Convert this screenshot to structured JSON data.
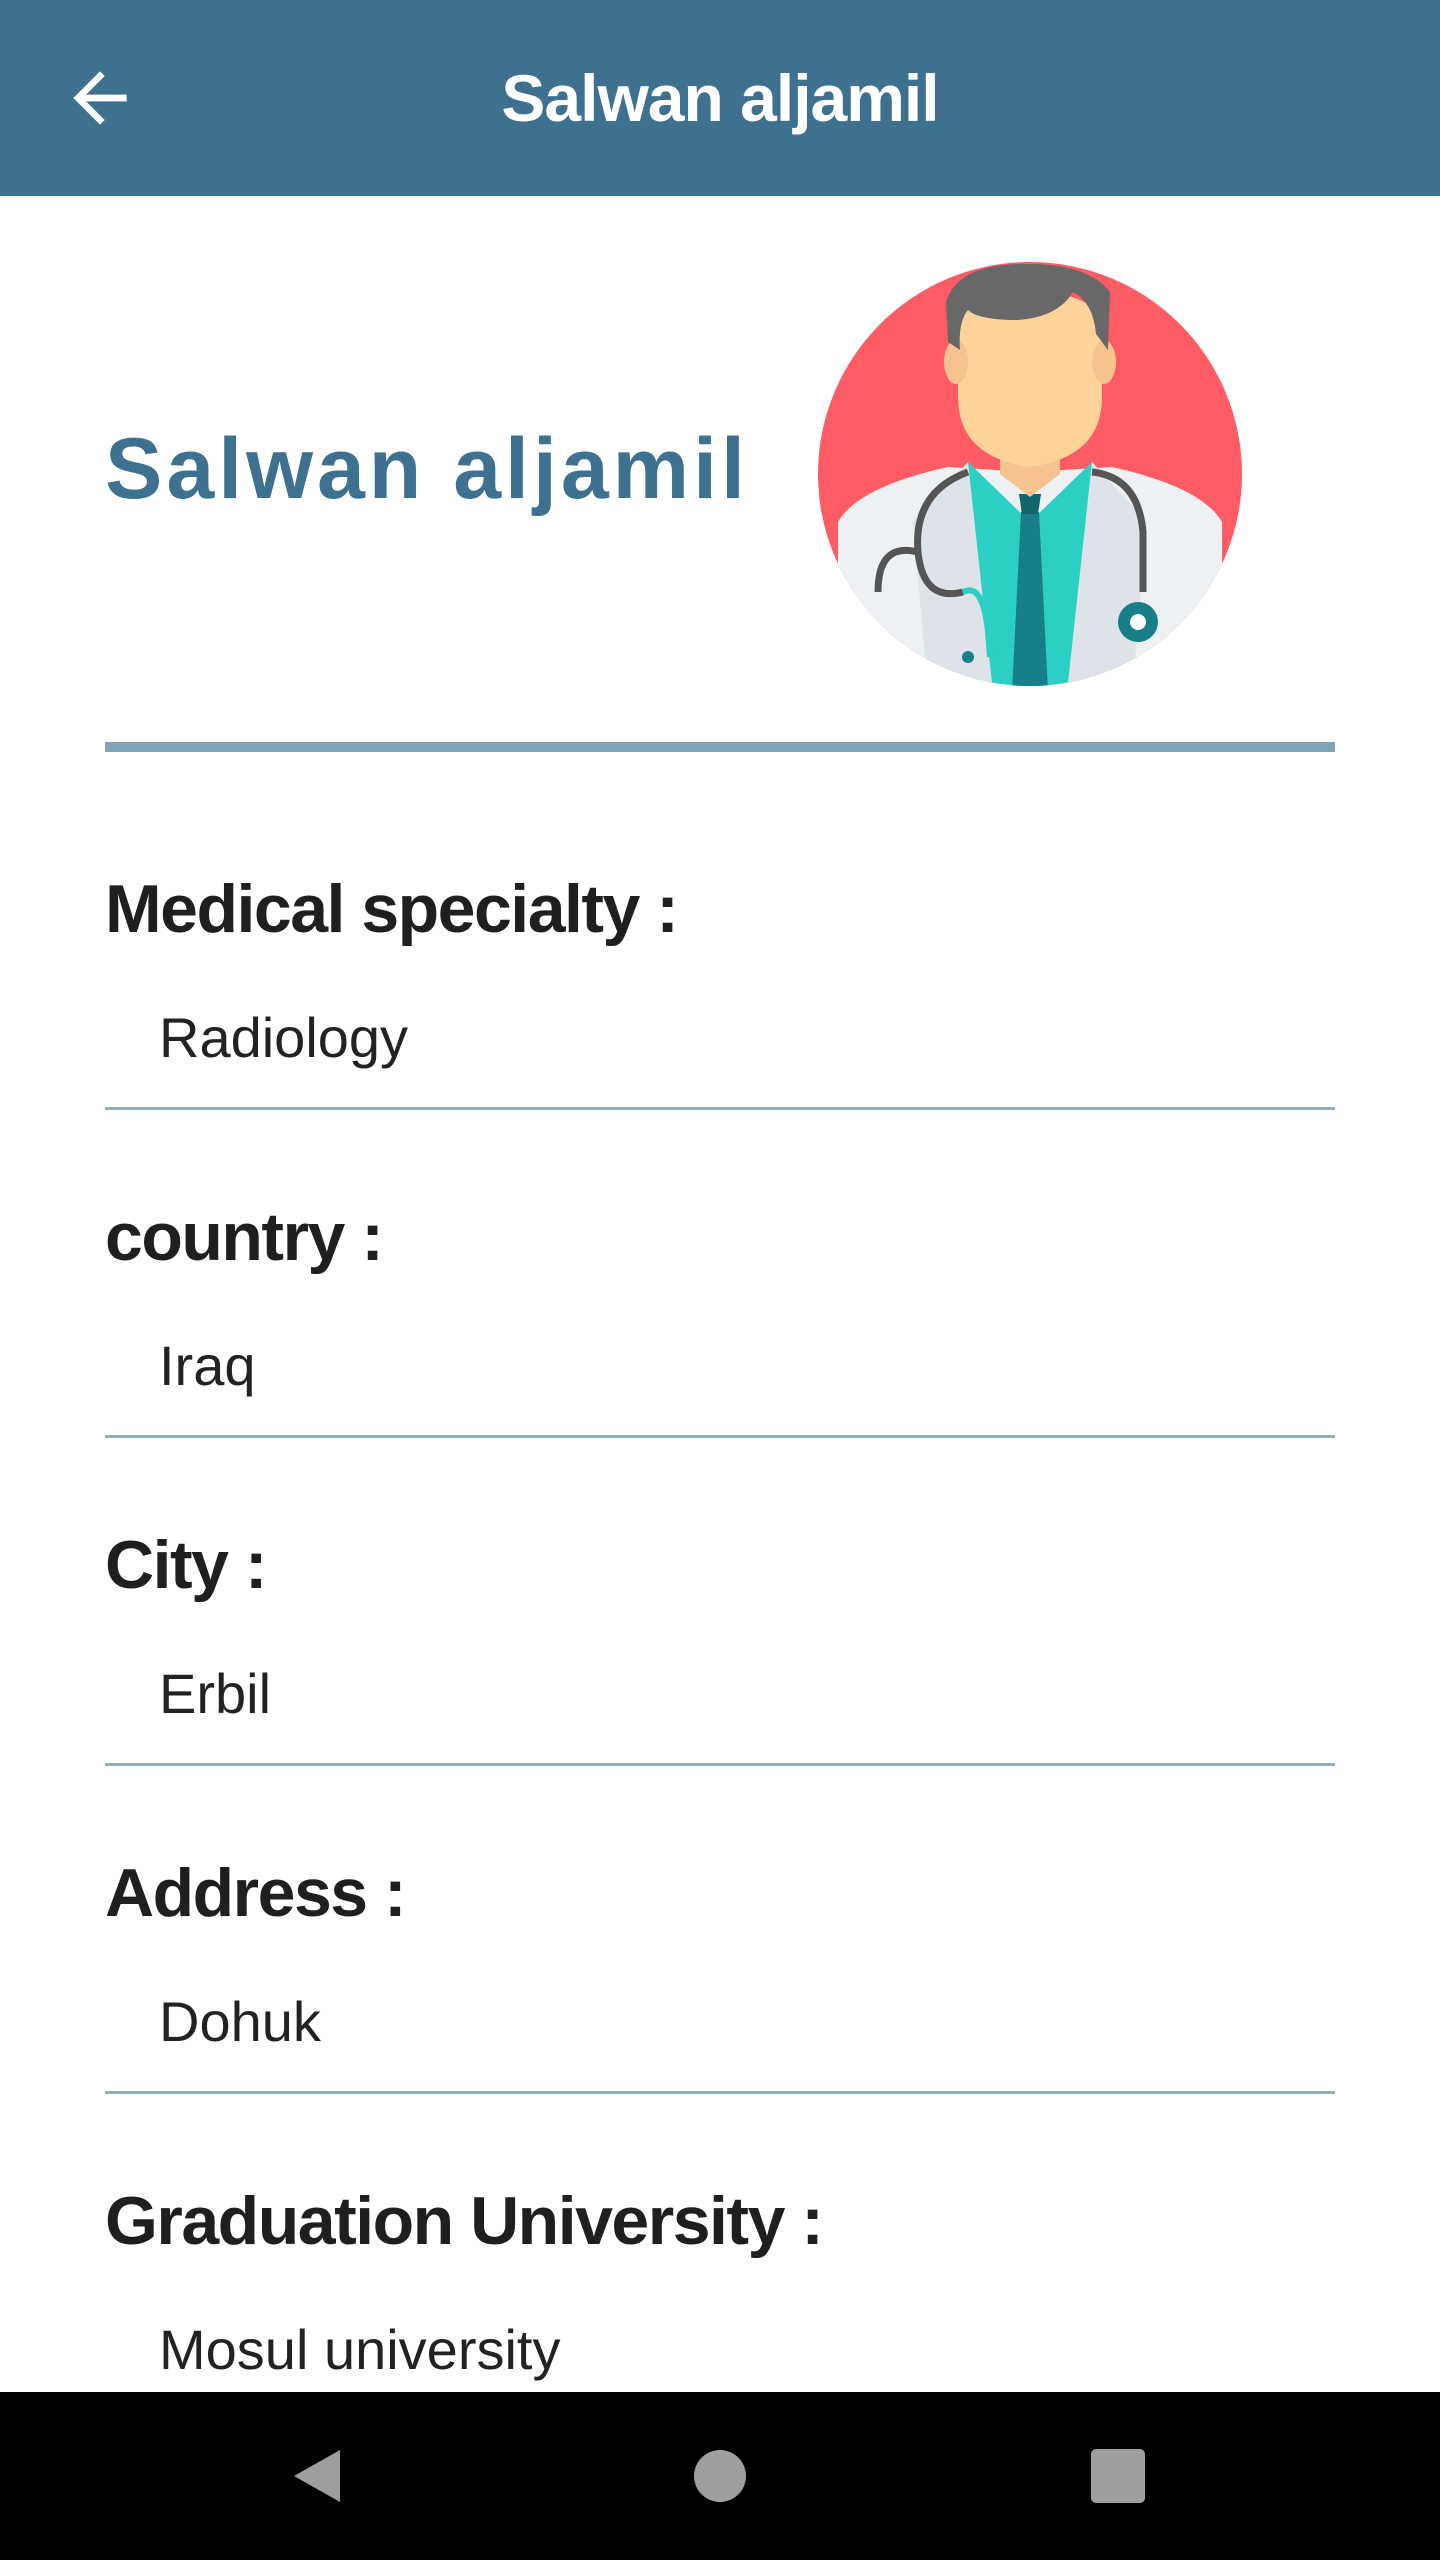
{
  "appbar": {
    "title": "Salwan aljamil",
    "back_icon": "arrow-left-icon"
  },
  "profile": {
    "name": "Salwan aljamil",
    "avatar_icon": "doctor-avatar-icon",
    "colors": {
      "primary": "#3d718f",
      "avatar_bg": "#fe5c65",
      "shirt": "#2ccfc3"
    }
  },
  "fields": [
    {
      "label": "Medical specialty :",
      "value": "Radiology"
    },
    {
      "label": "country :",
      "value": "Iraq"
    },
    {
      "label": "City :",
      "value": "Erbil"
    },
    {
      "label": "Address :",
      "value": "Dohuk"
    },
    {
      "label": "Graduation University :",
      "value": "Mosul university"
    }
  ],
  "navbar": {
    "back_icon": "triangle-back-icon",
    "home_icon": "circle-home-icon",
    "recents_icon": "square-recents-icon"
  }
}
